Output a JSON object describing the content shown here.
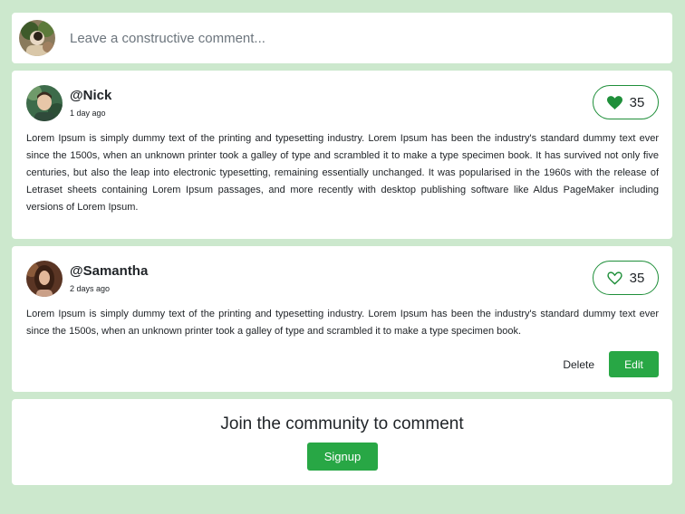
{
  "compose": {
    "placeholder": "Leave a constructive comment...",
    "avatar_icon": "user-avatar-photo"
  },
  "comments": [
    {
      "username": "@Nick",
      "timestamp": "1 day ago",
      "likes": "35",
      "liked": true,
      "like_icon": "heart-filled-icon",
      "text": "Lorem Ipsum is simply dummy text of the printing and typesetting industry. Lorem Ipsum has been the industry's standard dummy text ever since the 1500s, when an unknown printer took a galley of type and scrambled it to make a type specimen book. It has survived not only five centuries, but also the leap into electronic typesetting, remaining essentially unchanged. It was popularised in the 1960s with the release of Letraset sheets containing Lorem Ipsum passages, and more recently with desktop publishing software like Aldus PageMaker including versions of Lorem Ipsum."
    },
    {
      "username": "@Samantha",
      "timestamp": "2 days ago",
      "likes": "35",
      "liked": false,
      "like_icon": "heart-outline-icon",
      "text": "Lorem Ipsum is simply dummy text of the printing and typesetting industry. Lorem Ipsum has been the industry's standard dummy text ever since the 1500s, when an unknown printer took a galley of type and scrambled it to make a type specimen book.",
      "delete_label": "Delete",
      "edit_label": "Edit"
    }
  ],
  "join": {
    "title": "Join the community to comment",
    "signup_label": "Signup"
  },
  "colors": {
    "background": "#cce8cd",
    "accent": "#28a745",
    "heart": "#1f8f3a"
  }
}
